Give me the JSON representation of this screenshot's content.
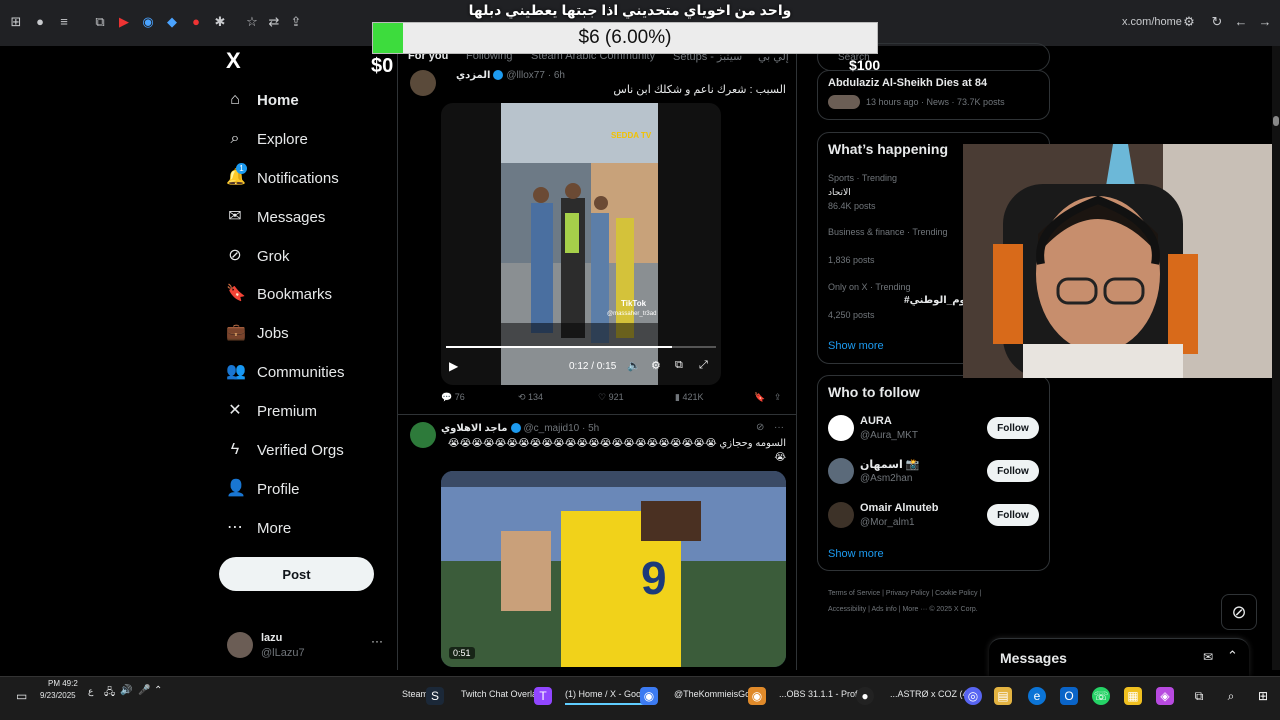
{
  "browser": {
    "url": "x.com/home"
  },
  "overlay": {
    "title": "واحد من اخوياي متحديني اذا جبتها يعطيني دبلها",
    "progress_text": "$6 (6.00%)",
    "progress_percent": 6,
    "goal_start": "$0",
    "goal_end": "$100",
    "fill_color": "#3ddc3d"
  },
  "nav": {
    "logo": "X",
    "items": [
      {
        "label": "Home",
        "icon": "home-icon"
      },
      {
        "label": "Explore",
        "icon": "search-icon"
      },
      {
        "label": "Notifications",
        "icon": "bell-icon",
        "badge": "1"
      },
      {
        "label": "Messages",
        "icon": "envelope-icon"
      },
      {
        "label": "Grok",
        "icon": "grok-icon"
      },
      {
        "label": "Bookmarks",
        "icon": "bookmark-icon"
      },
      {
        "label": "Jobs",
        "icon": "briefcase-icon"
      },
      {
        "label": "Communities",
        "icon": "people-icon"
      },
      {
        "label": "Premium",
        "icon": "x-icon"
      },
      {
        "label": "Verified Orgs",
        "icon": "lightning-icon"
      },
      {
        "label": "Profile",
        "icon": "person-icon"
      },
      {
        "label": "More",
        "icon": "more-circle-icon"
      }
    ],
    "post_label": "Post",
    "account": {
      "name": "lazu",
      "handle": "@lLazu7"
    }
  },
  "timeline": {
    "tabs": [
      "For you",
      "Following",
      "Steam Arabic Community",
      "Setups - سيتبز",
      "إلي بي"
    ],
    "tweet1": {
      "name": "المزدي",
      "handle": "@lllox77",
      "time": "6h",
      "text": "السبب : شعرك ناعم و شكلك ابن ناس",
      "video_time": "0:12 / 0:15",
      "video_caption": "@massaher_tr3ad",
      "logo": "SEDDA TV",
      "tiktok": "TikTok",
      "replies": "76",
      "reposts": "134",
      "likes": "921",
      "views": "421K"
    },
    "tweet2": {
      "name": "ماجد الاهلاوي",
      "handle": "@c_majid10",
      "time": "5h",
      "text": "السومه وحجازي 😭😭😭😭😭😭😭😭😭😭😭😭😭😭😭😭😭😭😭😭😭😭😭😭",
      "video_time": "0:51"
    }
  },
  "sidebar": {
    "search_placeholder": "Search",
    "news": {
      "title": "Abdulaziz Al-Sheikh Dies at 84",
      "meta": "13 hours ago · News · 73.7K posts"
    },
    "happening_title": "What’s happening",
    "trends": [
      {
        "category": "Sports · Trending",
        "name": "الاتحاد",
        "posts": "86.4K posts"
      },
      {
        "category": "Business & finance · Trending",
        "name": "",
        "posts": "1,836 posts"
      },
      {
        "category": "Only on X · Trending",
        "name": "#اليوم_الوطني",
        "posts": "4,250 posts"
      }
    ],
    "show_more": "Show more",
    "wtf_title": "Who to follow",
    "follow_label": "Follow",
    "who_to_follow": [
      {
        "name": "AURA",
        "handle": "@Aura_MKT"
      },
      {
        "name": "اسمهان 📸",
        "handle": "@Asm2han"
      },
      {
        "name": "Omair Almuteb",
        "handle": "@Mor_alm1"
      }
    ],
    "footer": [
      "Terms of Service",
      "Privacy Policy",
      "Cookie Policy",
      "Accessibility",
      "Ads info",
      "More ···",
      "© 2025 X Corp."
    ],
    "messages_title": "Messages"
  },
  "taskbar": {
    "time": "PM 49:2",
    "date": "9/23/2025",
    "lang": "ع",
    "apps": [
      "Steam",
      "Twitch Chat Overlay",
      "(1) Home / X - Goo...",
      "@TheKommieisGo...",
      "...OBS 31.1.1 - Profile",
      "...ASTRØ x COZ (47)"
    ]
  }
}
